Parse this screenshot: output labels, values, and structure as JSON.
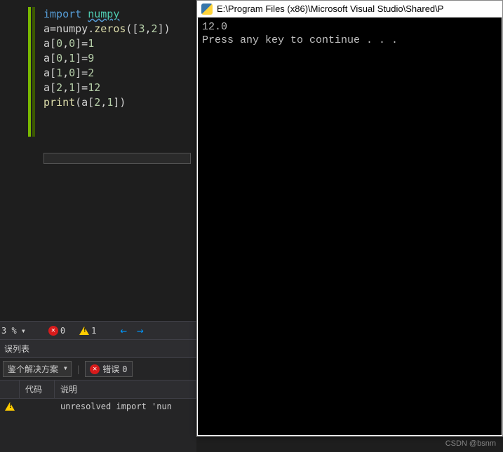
{
  "editor": {
    "lines": [
      {
        "tokens": [
          {
            "t": "import ",
            "c": "kw"
          },
          {
            "t": "numpy",
            "c": "mod"
          }
        ]
      },
      {
        "tokens": [
          {
            "t": "a=",
            "c": "var"
          },
          {
            "t": "numpy",
            "c": "op"
          },
          {
            "t": ".",
            "c": "punc"
          },
          {
            "t": "zeros",
            "c": "fn"
          },
          {
            "t": "([",
            "c": "punc"
          },
          {
            "t": "3",
            "c": "num"
          },
          {
            "t": ",",
            "c": "punc"
          },
          {
            "t": "2",
            "c": "num"
          },
          {
            "t": "])",
            "c": "punc"
          }
        ]
      },
      {
        "tokens": [
          {
            "t": "a[",
            "c": "var"
          },
          {
            "t": "0",
            "c": "num"
          },
          {
            "t": ",",
            "c": "punc"
          },
          {
            "t": "0",
            "c": "num"
          },
          {
            "t": "]=",
            "c": "var"
          },
          {
            "t": "1",
            "c": "num"
          }
        ]
      },
      {
        "tokens": [
          {
            "t": "a[",
            "c": "var"
          },
          {
            "t": "0",
            "c": "num"
          },
          {
            "t": ",",
            "c": "punc"
          },
          {
            "t": "1",
            "c": "num"
          },
          {
            "t": "]=",
            "c": "var"
          },
          {
            "t": "9",
            "c": "num"
          }
        ]
      },
      {
        "tokens": [
          {
            "t": "a[",
            "c": "var"
          },
          {
            "t": "1",
            "c": "num"
          },
          {
            "t": ",",
            "c": "punc"
          },
          {
            "t": "0",
            "c": "num"
          },
          {
            "t": "]=",
            "c": "var"
          },
          {
            "t": "2",
            "c": "num"
          }
        ]
      },
      {
        "tokens": [
          {
            "t": "a[",
            "c": "var"
          },
          {
            "t": "2",
            "c": "num"
          },
          {
            "t": ",",
            "c": "punc"
          },
          {
            "t": "1",
            "c": "num"
          },
          {
            "t": "]=",
            "c": "var"
          },
          {
            "t": "12",
            "c": "num"
          }
        ]
      },
      {
        "tokens": [
          {
            "t": "print",
            "c": "fn"
          },
          {
            "t": "(a[",
            "c": "punc"
          },
          {
            "t": "2",
            "c": "num"
          },
          {
            "t": ",",
            "c": "punc"
          },
          {
            "t": "1",
            "c": "num"
          },
          {
            "t": "])",
            "c": "punc"
          }
        ]
      }
    ]
  },
  "zoomBar": {
    "zoom": "3 %",
    "errors": "0",
    "warnings": "1"
  },
  "errorList": {
    "title": "误列表",
    "scope": "鉴个解决方案",
    "errFilter": "错误",
    "errCount": "0",
    "columns": {
      "code": "代码",
      "desc": "说明"
    },
    "rows": [
      {
        "type": "warn",
        "code": "",
        "desc": "unresolved import 'nun"
      }
    ]
  },
  "console": {
    "title": "E:\\Program Files (x86)\\Microsoft Visual Studio\\Shared\\P",
    "output": "12.0\nPress any key to continue . . ."
  },
  "watermark": "CSDN @bsnm"
}
